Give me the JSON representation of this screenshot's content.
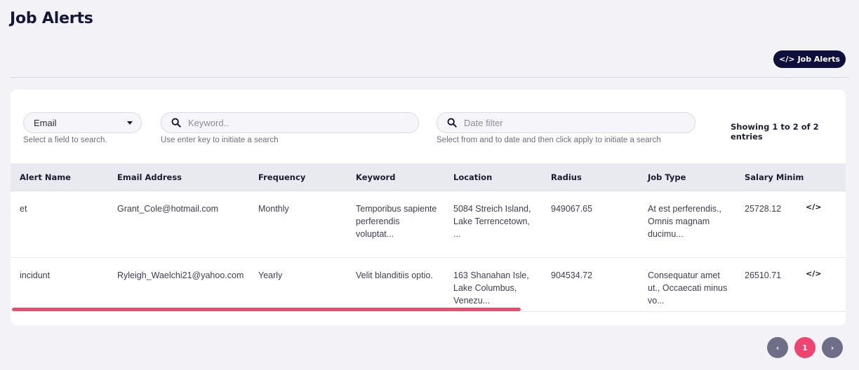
{
  "page": {
    "title": "Job Alerts"
  },
  "toolbar": {
    "embed_icon": "</>",
    "embed_label": "Job Alerts"
  },
  "filters": {
    "field_select": {
      "value": "Email",
      "hint": "Select a field to search."
    },
    "keyword": {
      "placeholder": "Keyword..",
      "hint": "Use enter key to initiate a search"
    },
    "date": {
      "placeholder": "Date filter",
      "hint": "Select from and to date and then click apply to initiate a search"
    },
    "showing": "Showing 1 to 2 of 2 entries"
  },
  "table": {
    "headers": [
      "Alert Name",
      "Email Address",
      "Frequency",
      "Keyword",
      "Location",
      "Radius",
      "Job Type",
      "Salary Minim"
    ],
    "rows": [
      {
        "alert_name": "et",
        "email": "Grant_Cole@hotmail.com",
        "frequency": "Monthly",
        "keyword": "Temporibus sapiente perferendis voluptat...",
        "location": "5084 Streich Island, Lake Terrencetown, ...",
        "radius": "949067.65",
        "job_type": "At est perferendis., Omnis magnam ducimu...",
        "salary_min": "25728.12",
        "action": "</>"
      },
      {
        "alert_name": "incidunt",
        "email": "Ryleigh_Waelchi21@yahoo.com",
        "frequency": "Yearly",
        "keyword": "Velit blanditiis optio.",
        "location": "163 Shanahan Isle, Lake Columbus, Venezu...",
        "radius": "904534.72",
        "job_type": "Consequatur amet ut., Occaecati minus vo...",
        "salary_min": "26510.71",
        "action": "</>"
      }
    ]
  },
  "pagination": {
    "prev": "‹",
    "current": "1",
    "next": "›"
  },
  "colors": {
    "accent": "#ef4370",
    "dark": "#0f0f3d",
    "nav": "#6e6e88"
  }
}
